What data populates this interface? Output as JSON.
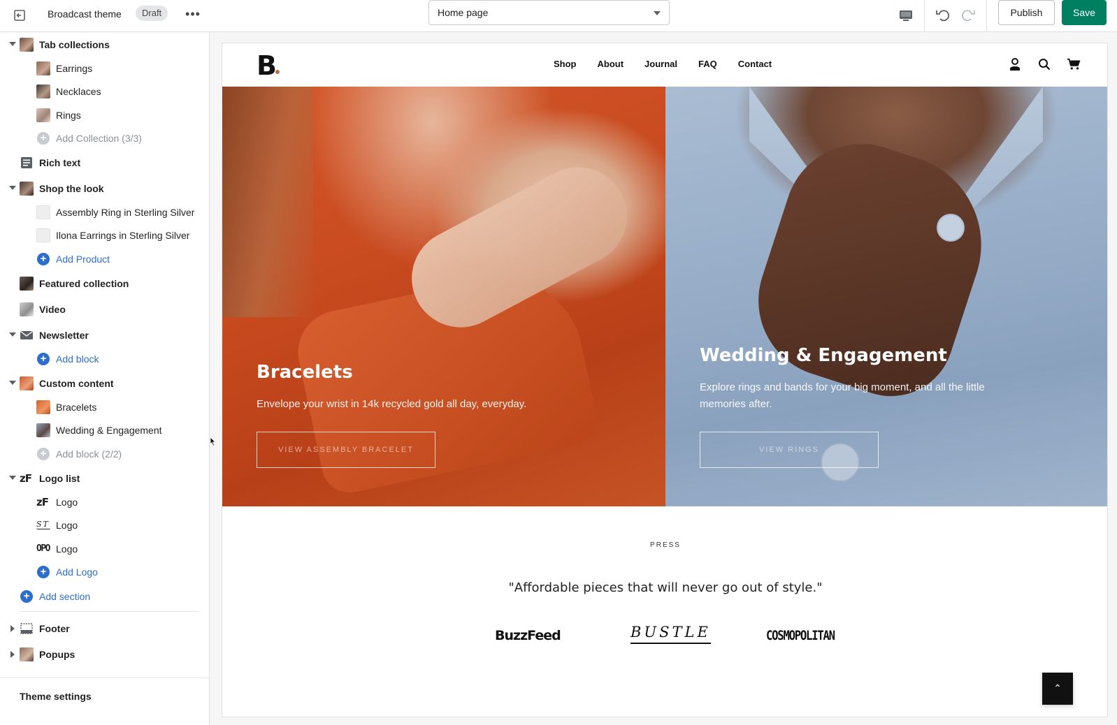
{
  "topbar": {
    "theme_name": "Broadcast theme",
    "status_badge": "Draft",
    "more_label": "•••",
    "page_select": "Home page",
    "publish_label": "Publish",
    "save_label": "Save",
    "save_color": "#008060"
  },
  "sidebar": {
    "sections": [
      {
        "label": "Tab collections",
        "expanded": true,
        "icon": "image-thumb"
      },
      {
        "label": "Earrings",
        "icon": "image-thumb"
      },
      {
        "label": "Necklaces",
        "icon": "image-thumb"
      },
      {
        "label": "Rings",
        "icon": "image-thumb"
      },
      {
        "label": "Add Collection (3/3)",
        "icon": "plus-circle-icon",
        "disabled": true
      },
      {
        "label": "Rich text",
        "icon": "text-block-icon"
      },
      {
        "label": "Shop the look",
        "expanded": true,
        "icon": "image-thumb"
      },
      {
        "label": "Assembly Ring in Sterling Silver",
        "icon": "image-thumb"
      },
      {
        "label": "Ilona Earrings in Sterling Silver",
        "icon": "image-thumb"
      },
      {
        "label": "Add Product",
        "icon": "plus-circle-icon"
      },
      {
        "label": "Featured collection",
        "icon": "image-thumb"
      },
      {
        "label": "Video",
        "icon": "image-thumb"
      },
      {
        "label": "Newsletter",
        "expanded": true,
        "icon": "envelope-icon"
      },
      {
        "label": "Add block",
        "icon": "plus-circle-icon"
      },
      {
        "label": "Custom content",
        "expanded": true,
        "icon": "image-thumb"
      },
      {
        "label": "Bracelets",
        "icon": "image-thumb"
      },
      {
        "label": "Wedding & Engagement",
        "icon": "image-thumb"
      },
      {
        "label": "Add block (2/2)",
        "icon": "plus-circle-icon",
        "disabled": true
      },
      {
        "label": "Logo list",
        "expanded": true,
        "icon": "zf-logo-icon"
      },
      {
        "label": "Logo",
        "icon": "zf-logo-icon"
      },
      {
        "label": "Logo",
        "icon": "st-logo-icon"
      },
      {
        "label": "Logo",
        "icon": "opo-logo-icon"
      },
      {
        "label": "Add Logo",
        "icon": "plus-circle-icon"
      },
      {
        "label": "Add section",
        "icon": "plus-circle-icon"
      },
      {
        "label": "Footer",
        "expanded": false,
        "icon": "footer-icon"
      },
      {
        "label": "Popups",
        "expanded": false,
        "icon": "image-thumb"
      }
    ],
    "theme_settings": "Theme settings",
    "logo_glyphs": {
      "zf": "zF",
      "st": "ST",
      "opo": "OPO"
    }
  },
  "store": {
    "logo": "B",
    "nav": [
      "Shop",
      "About",
      "Journal",
      "FAQ",
      "Contact"
    ],
    "hero": [
      {
        "title": "Bracelets",
        "text": "Envelope your wrist in 14k recycled gold all day, everyday.",
        "button": "VIEW ASSEMBLY BRACELET"
      },
      {
        "title": "Wedding & Engagement",
        "text_line1": "Explore rings and bands for your big moment, and all the little",
        "text_line2": "memories after.",
        "button": "VIEW RINGS"
      }
    ],
    "press": {
      "label": "PRESS",
      "quote": "\"Affordable pieces that will never go out of style.\"",
      "logos": [
        "BuzzFeed",
        "BUSTLE",
        "COSMOPOLITAN"
      ]
    },
    "scroll_top": "⌃"
  }
}
